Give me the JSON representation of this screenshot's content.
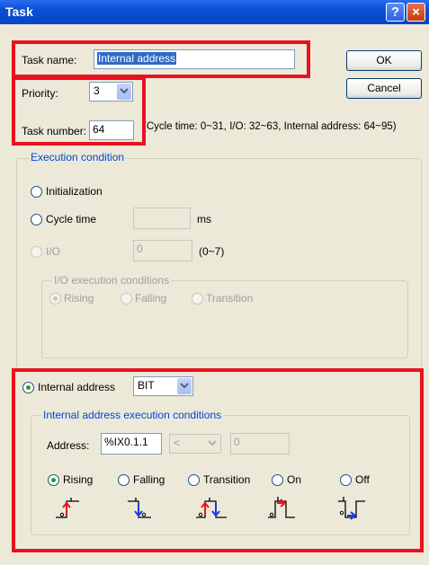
{
  "window": {
    "title": "Task",
    "help_glyph": "?",
    "close_glyph": "×"
  },
  "task": {
    "name_label": "Task name:",
    "name_value": "Internal address",
    "priority_label": "Priority:",
    "priority_value": "3",
    "number_label": "Task number:",
    "number_value": "64",
    "hint": "(Cycle time: 0~31, I/O: 32~63, Internal address: 64~95)"
  },
  "buttons": {
    "ok": "OK",
    "cancel": "Cancel"
  },
  "execution": {
    "title": "Execution condition",
    "initialization": "Initialization",
    "cycle_time": "Cycle time",
    "cycle_unit": "ms",
    "io": "I/O",
    "io_value": "0",
    "io_range": "(0~7)",
    "io_conditions_title": "I/O execution conditions",
    "io_rising": "Rising",
    "io_falling": "Falling",
    "io_transition": "Transition"
  },
  "internal": {
    "label": "Internal address",
    "type_value": "BIT",
    "conditions_title": "Internal address execution conditions",
    "address_label": "Address:",
    "address_value": "%IX0.1.1",
    "operator_value": "<",
    "compare_value": "0",
    "rising": "Rising",
    "falling": "Falling",
    "transition": "Transition",
    "on": "On",
    "off": "Off",
    "selected": "Rising"
  },
  "icons": {
    "rising_edge": "rising-edge-icon",
    "falling_edge": "falling-edge-icon",
    "transition_edge": "transition-edge-icon",
    "on_level": "on-level-icon",
    "off_level": "off-level-icon"
  },
  "colors": {
    "highlight": "#e8121e",
    "group_title": "#0046d5",
    "titlebar": "#0a4fd6"
  }
}
